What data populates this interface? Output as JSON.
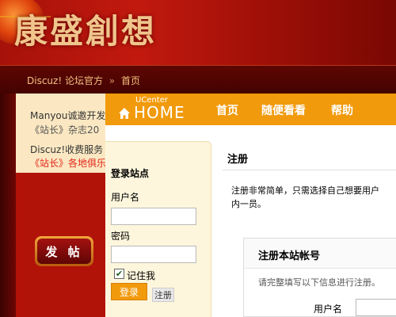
{
  "background_site": {
    "logo_text": "康盛創想",
    "breadcrumb": [
      "Discuz! 论坛官方",
      "»",
      "首页"
    ],
    "announcements": [
      "Manyou诚邀开发",
      "《站长》杂志20",
      "Discuz!收费服务",
      "《站长》各地俱乐"
    ],
    "post_button_label": "发 帖"
  },
  "ucenter": {
    "logo_small": "UCenter",
    "logo_big": "HOME",
    "nav": [
      "首页",
      "随便看看",
      "帮助"
    ],
    "login": {
      "title": "登录站点",
      "username_label": "用户名",
      "password_label": "密码",
      "remember_label": "记住我",
      "remember_checked": true,
      "login_button": "登录",
      "register_link": "注册"
    },
    "main": {
      "title": "注册",
      "intro_line1": "注册非常简单，只需选择自己想要用户",
      "intro_line2": "内一员。",
      "box_title": "注册本站帐号",
      "box_hint": "请完整填写以下信息进行注册。",
      "username_label": "用户名"
    }
  },
  "colors": {
    "ucenter_orange": "#f19a0c",
    "site_red": "#b11309",
    "alert_red": "#e5251a"
  }
}
